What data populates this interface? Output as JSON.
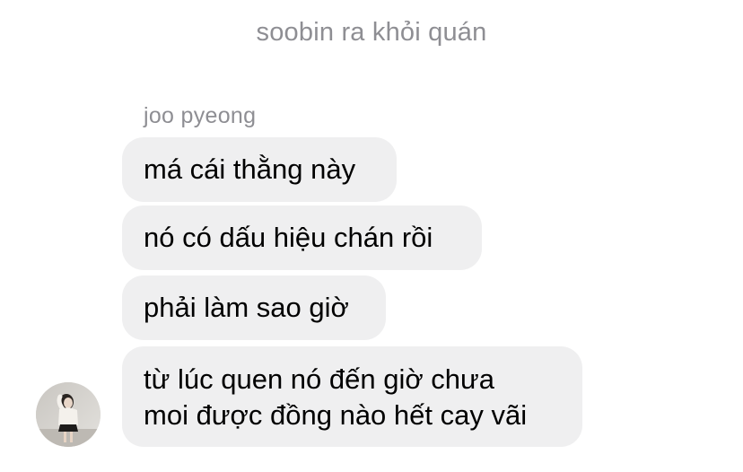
{
  "system_note": "soobin ra khỏi quán",
  "sender": {
    "name": "joo pyeong",
    "avatar_icon": "profile-photo-avatar"
  },
  "messages": [
    {
      "lines": [
        "má cái thằng này"
      ]
    },
    {
      "lines": [
        "nó có dấu hiệu chán rồi"
      ]
    },
    {
      "lines": [
        "phải làm sao giờ"
      ]
    },
    {
      "lines": [
        "từ lúc quen nó đến giờ chưa",
        "moi được đồng nào hết cay vãi"
      ]
    }
  ],
  "colors": {
    "bubble_bg": "#efeff0",
    "meta_text": "#8e8e93",
    "message_text": "#000000"
  }
}
